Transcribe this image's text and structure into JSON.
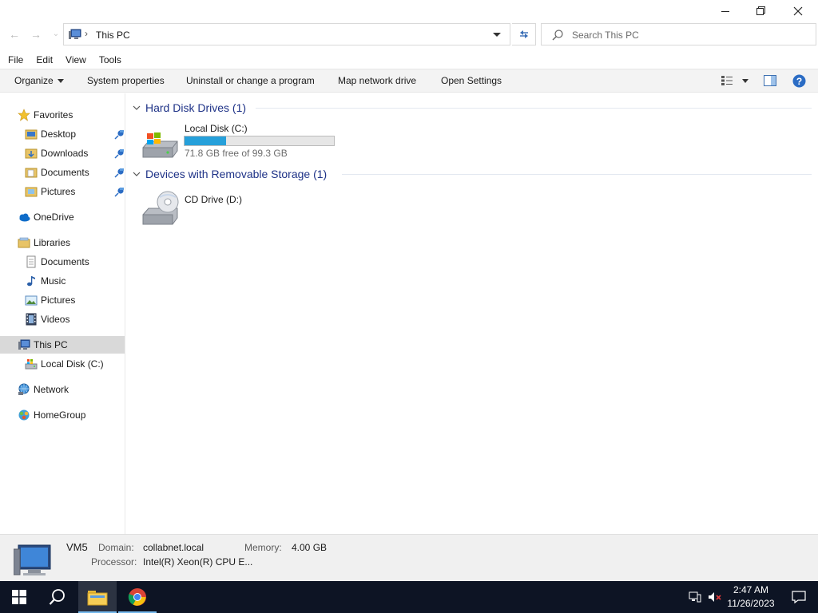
{
  "window": {
    "minimize_icon": "minimize-icon",
    "restore_icon": "restore-icon",
    "close_icon": "close-icon"
  },
  "address": {
    "path": "This PC",
    "search_placeholder": "Search This PC"
  },
  "menu": [
    "File",
    "Edit",
    "View",
    "Tools"
  ],
  "commands": {
    "organize": "Organize",
    "system_properties": "System properties",
    "uninstall": "Uninstall or change a program",
    "map_drive": "Map network drive",
    "open_settings": "Open Settings"
  },
  "nav": {
    "favorites": "Favorites",
    "desktop": "Desktop",
    "downloads": "Downloads",
    "documents": "Documents",
    "pictures": "Pictures",
    "onedrive": "OneDrive",
    "libraries": "Libraries",
    "lib_documents": "Documents",
    "lib_music": "Music",
    "lib_pictures": "Pictures",
    "lib_videos": "Videos",
    "this_pc": "This PC",
    "local_disk": "Local Disk (C:)",
    "network": "Network",
    "homegroup": "HomeGroup"
  },
  "content": {
    "hdd_group": "Hard Disk Drives (1)",
    "removable_group": "Devices with Removable Storage (1)",
    "local_disk_name": "Local Disk (C:)",
    "local_disk_free": "71.8 GB free of 99.3 GB",
    "local_disk_used_fraction": 0.277,
    "cd_drive_name": "CD Drive (D:)"
  },
  "details": {
    "computer_name": "VM5",
    "domain_label": "Domain:",
    "domain_value": "collabnet.local",
    "memory_label": "Memory:",
    "memory_value": "4.00 GB",
    "processor_label": "Processor:",
    "processor_value": "Intel(R) Xeon(R) CPU E..."
  },
  "taskbar": {
    "time": "2:47 AM",
    "date": "11/26/2023"
  },
  "colors": {
    "accent": "#26a0da",
    "group_header": "#1e3287",
    "taskbar": "#0d1424"
  }
}
